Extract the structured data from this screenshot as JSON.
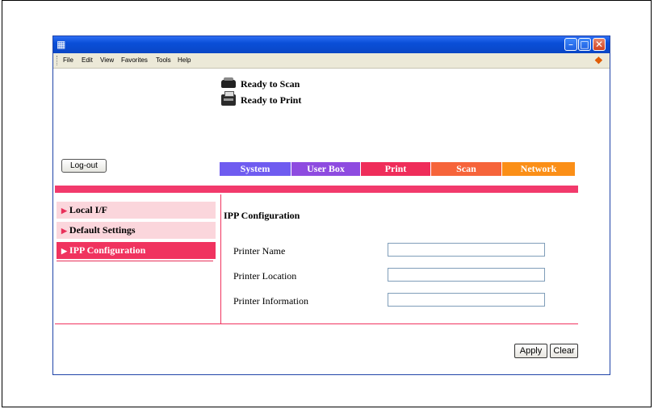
{
  "browser": {
    "menu": [
      "File",
      "Edit",
      "View",
      "Favorites",
      "Tools",
      "Help"
    ]
  },
  "status": {
    "scan": "Ready to Scan",
    "print": "Ready to Print"
  },
  "logout_label": "Log-out",
  "tabs": [
    "System",
    "User Box",
    "Print",
    "Scan",
    "Network"
  ],
  "nav": [
    {
      "label": "Local I/F",
      "active": false
    },
    {
      "label": "Default Settings",
      "active": false
    },
    {
      "label": "IPP Configuration",
      "active": true
    }
  ],
  "content": {
    "title": "IPP Configuration",
    "fields": [
      {
        "label": "Printer Name",
        "value": ""
      },
      {
        "label": "Printer Location",
        "value": ""
      },
      {
        "label": "Printer Information",
        "value": ""
      }
    ]
  },
  "buttons": {
    "apply": "Apply",
    "clear": "Clear"
  },
  "colors": {
    "accent": "#f0335f",
    "tab_system": "#6f5cf0",
    "tab_userbox": "#8e4be0",
    "tab_print": "#ef2d5a",
    "tab_scan": "#f6643a",
    "tab_network": "#fb8f17"
  }
}
